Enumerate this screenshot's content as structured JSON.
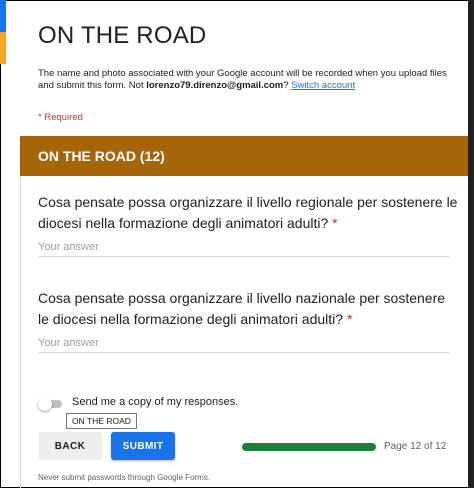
{
  "form": {
    "title": "ON THE ROAD",
    "notice_prefix": "The name and photo associated with your Google account will be recorded when you upload files and submit this form. Not ",
    "account_email": "lorenzo79.direnzo@gmail.com",
    "notice_suffix": "? ",
    "switch_account_label": "Switch account",
    "required_label": "* Required"
  },
  "section": {
    "header": "ON THE ROAD (12)"
  },
  "questions": [
    {
      "text": "Cosa pensate possa organizzare il livello regionale per sostenere le diocesi nella formazione degli animatori adulti?",
      "required_mark": "*",
      "placeholder": "Your answer"
    },
    {
      "text": "Cosa pensate possa organizzare il livello nazionale per sostenere le diocesi nella formazione degli animatori adulti?",
      "required_mark": "*",
      "placeholder": "Your answer"
    }
  ],
  "send_copy": {
    "label": "Send me a copy of my responses.",
    "checked": false,
    "tooltip": "ON THE ROAD"
  },
  "nav": {
    "back_label": "BACK",
    "submit_label": "SUBMIT",
    "page_indicator": "Page 12 of 12",
    "progress": 1.0
  },
  "footer": {
    "note": "Never submit passwords through Google Forms."
  },
  "colors": {
    "section_header": "#a7650a",
    "accent_blue": "#1a73e8",
    "required_red": "#d93025",
    "progress_green": "#188038"
  }
}
